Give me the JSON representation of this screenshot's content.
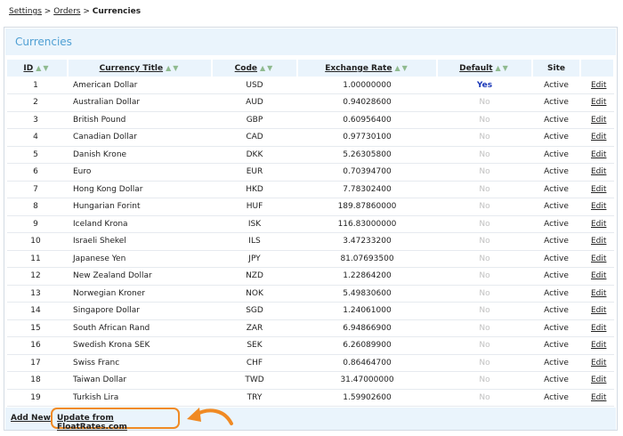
{
  "breadcrumb": {
    "settings": "Settings",
    "sep1": ">",
    "orders": "Orders",
    "sep2": ">",
    "current": "Currencies"
  },
  "panel": {
    "title": "Currencies"
  },
  "table": {
    "headers": {
      "id": "ID",
      "title": "Currency Title",
      "code": "Code",
      "rate": "Exchange Rate",
      "default": "Default",
      "site": "Site"
    },
    "sort_glyphs": "▲▼",
    "edit_label": "Edit",
    "rows": [
      {
        "id": "1",
        "title": "American Dollar",
        "code": "USD",
        "rate": "1.00000000",
        "default": "Yes",
        "site": "Active"
      },
      {
        "id": "2",
        "title": "Australian Dollar",
        "code": "AUD",
        "rate": "0.94028600",
        "default": "No",
        "site": "Active"
      },
      {
        "id": "3",
        "title": "British Pound",
        "code": "GBP",
        "rate": "0.60956400",
        "default": "No",
        "site": "Active"
      },
      {
        "id": "4",
        "title": "Canadian Dollar",
        "code": "CAD",
        "rate": "0.97730100",
        "default": "No",
        "site": "Active"
      },
      {
        "id": "5",
        "title": "Danish Krone",
        "code": "DKK",
        "rate": "5.26305800",
        "default": "No",
        "site": "Active"
      },
      {
        "id": "6",
        "title": "Euro",
        "code": "EUR",
        "rate": "0.70394700",
        "default": "No",
        "site": "Active"
      },
      {
        "id": "7",
        "title": "Hong Kong Dollar",
        "code": "HKD",
        "rate": "7.78302400",
        "default": "No",
        "site": "Active"
      },
      {
        "id": "8",
        "title": "Hungarian Forint",
        "code": "HUF",
        "rate": "189.87860000",
        "default": "No",
        "site": "Active"
      },
      {
        "id": "9",
        "title": "Iceland Krona",
        "code": "ISK",
        "rate": "116.83000000",
        "default": "No",
        "site": "Active"
      },
      {
        "id": "10",
        "title": "Israeli Shekel",
        "code": "ILS",
        "rate": "3.47233200",
        "default": "No",
        "site": "Active"
      },
      {
        "id": "11",
        "title": "Japanese Yen",
        "code": "JPY",
        "rate": "81.07693500",
        "default": "No",
        "site": "Active"
      },
      {
        "id": "12",
        "title": "New Zealand Dollar",
        "code": "NZD",
        "rate": "1.22864200",
        "default": "No",
        "site": "Active"
      },
      {
        "id": "13",
        "title": "Norwegian Kroner",
        "code": "NOK",
        "rate": "5.49830600",
        "default": "No",
        "site": "Active"
      },
      {
        "id": "14",
        "title": "Singapore Dollar",
        "code": "SGD",
        "rate": "1.24061000",
        "default": "No",
        "site": "Active"
      },
      {
        "id": "15",
        "title": "South African Rand",
        "code": "ZAR",
        "rate": "6.94866900",
        "default": "No",
        "site": "Active"
      },
      {
        "id": "16",
        "title": "Swedish Krona SEK",
        "code": "SEK",
        "rate": "6.26089900",
        "default": "No",
        "site": "Active"
      },
      {
        "id": "17",
        "title": "Swiss Franc",
        "code": "CHF",
        "rate": "0.86464700",
        "default": "No",
        "site": "Active"
      },
      {
        "id": "18",
        "title": "Taiwan Dollar",
        "code": "TWD",
        "rate": "31.47000000",
        "default": "No",
        "site": "Active"
      },
      {
        "id": "19",
        "title": "Turkish Lira",
        "code": "TRY",
        "rate": "1.59902600",
        "default": "No",
        "site": "Active"
      }
    ]
  },
  "footer": {
    "add_new": "Add New",
    "update": "Update from FloatRates.com"
  },
  "colors": {
    "accent_blue": "#4f9fd3",
    "header_bg": "#eaf4fc",
    "highlight_orange": "#f08a24",
    "default_yes": "#1a38b8",
    "sort_arrow": "#8fba8f"
  }
}
